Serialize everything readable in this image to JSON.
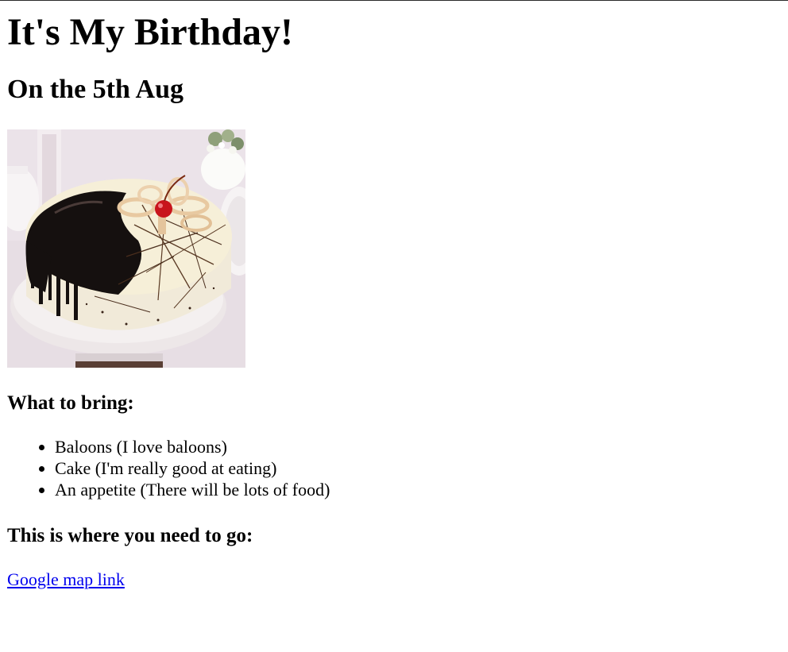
{
  "page": {
    "title": "It's My Birthday!",
    "date": "On the 5th Aug",
    "image": {
      "subject": "cake-photo",
      "colors": {
        "chocolate": "#1a1110",
        "cream": "#f4ecd8",
        "cherry": "#c8141c",
        "background": "#e9e2e6",
        "plate": "#f1eded"
      }
    },
    "bring": {
      "heading": "What to bring:",
      "items": [
        "Baloons (I love baloons)",
        "Cake (I'm really good at eating)",
        "An appetite (There will be lots of food)"
      ]
    },
    "directions": {
      "heading": "This is where you need to go:",
      "link_text": "Google map link",
      "link_color": "#0000ee"
    }
  }
}
